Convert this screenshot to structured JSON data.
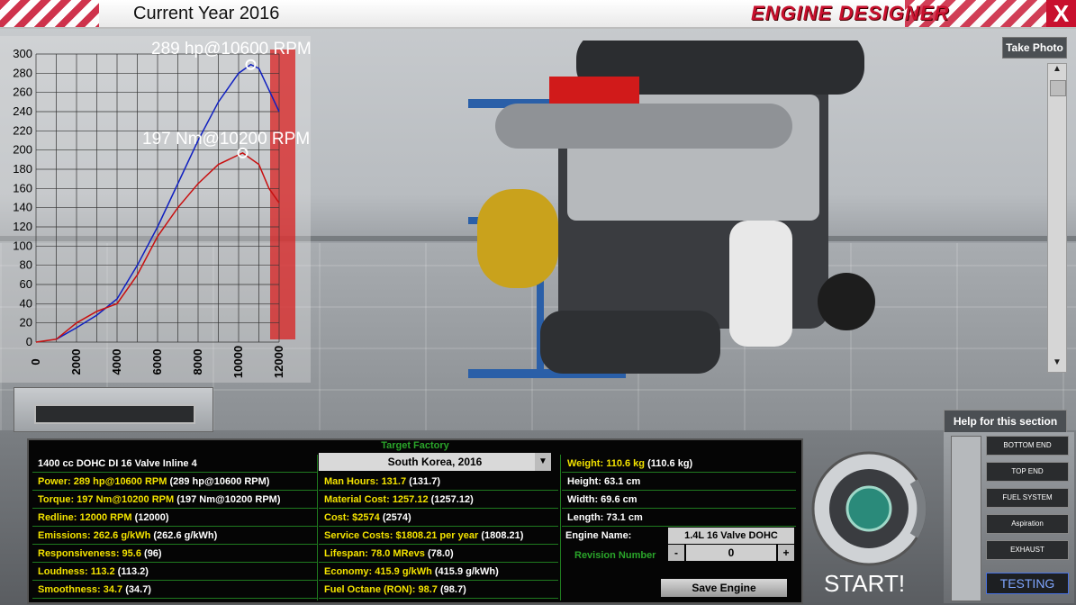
{
  "header": {
    "current_year": "Current Year 2016",
    "app_title": "ENGINE DESIGNER",
    "close_label": "X"
  },
  "scene": {
    "take_photo_label": "Take Photo",
    "help_label": "Help for this section"
  },
  "chart_data": {
    "type": "line",
    "annotations": [
      "289 hp@10600 RPM",
      "197 Nm@10200 RPM"
    ],
    "x_ticks": [
      "0",
      "2000",
      "4000",
      "6000",
      "8000",
      "10000",
      "12000"
    ],
    "y_ticks": [
      "0",
      "20",
      "40",
      "60",
      "80",
      "100",
      "120",
      "140",
      "160",
      "180",
      "200",
      "220",
      "240",
      "260",
      "280",
      "300"
    ],
    "xlim": [
      0,
      12000
    ],
    "ylim": [
      0,
      300
    ],
    "grid": true,
    "series": [
      {
        "color": "#1020c0",
        "x": [
          1000,
          2000,
          3000,
          4000,
          5000,
          6000,
          7000,
          8000,
          9000,
          10000,
          10600,
          11000,
          12000
        ],
        "values": [
          3,
          15,
          28,
          45,
          80,
          120,
          165,
          210,
          250,
          280,
          289,
          285,
          240
        ]
      },
      {
        "color": "#c81010",
        "x": [
          0,
          1000,
          2000,
          3000,
          4000,
          5000,
          6000,
          7000,
          8000,
          9000,
          10200,
          11000,
          11500,
          12000
        ],
        "values": [
          0,
          3,
          20,
          32,
          40,
          70,
          110,
          140,
          165,
          185,
          197,
          185,
          160,
          145
        ]
      }
    ]
  },
  "stats": {
    "target_factory_label": "Target Factory",
    "engine_summary": "1400 cc DOHC DI 16 Valve Inline 4",
    "factory_value": "South Korea, 2016",
    "col1": [
      {
        "label": "Power:",
        "value": "289 hp@10600 RPM",
        "extra": "(289 hp@10600 RPM)"
      },
      {
        "label": "Torque:",
        "value": "197 Nm@10200 RPM",
        "extra": "(197 Nm@10200 RPM)"
      },
      {
        "label": "Redline:",
        "value": "12000 RPM",
        "extra": "(12000)"
      },
      {
        "label": "Emissions:",
        "value": "262.6 g/kWh",
        "extra": "(262.6 g/kWh)"
      },
      {
        "label": "Responsiveness:",
        "value": "95.6",
        "extra": "(96)"
      },
      {
        "label": "Loudness:",
        "value": "113.2",
        "extra": "(113.2)"
      },
      {
        "label": "Smoothness:",
        "value": "34.7",
        "extra": "(34.7)"
      }
    ],
    "col2": [
      {
        "label": "Man Hours:",
        "value": "131.7",
        "extra": "(131.7)"
      },
      {
        "label": "Material Cost:",
        "value": "1257.12",
        "extra": "(1257.12)"
      },
      {
        "label": "Cost:",
        "value": "$2574",
        "extra": "(2574)"
      },
      {
        "label": "Service Costs:",
        "value": "$1808.21 per year",
        "extra": "(1808.21)"
      },
      {
        "label": "Lifespan:",
        "value": "78.0 MRevs",
        "extra": "(78.0)"
      },
      {
        "label": "Economy:",
        "value": "415.9 g/kWh",
        "extra": "(415.9 g/kWh)"
      },
      {
        "label": "Fuel Octane (RON):",
        "value": "98.7",
        "extra": "(98.7)"
      }
    ],
    "col3": [
      {
        "label": "Weight:",
        "value": "110.6 kg",
        "extra": "(110.6 kg)"
      },
      {
        "label": "Height:",
        "value": "63.1 cm",
        "extra": ""
      },
      {
        "label": "Width:",
        "value": "69.6 cm",
        "extra": ""
      },
      {
        "label": "Length:",
        "value": "73.1 cm",
        "extra": ""
      }
    ],
    "engine_name_label": "Engine Name:",
    "engine_name_value": "1.4L 16 Valve DOHC",
    "revision_label": "Revision Number",
    "revision_value": "0",
    "minus_label": "-",
    "plus_label": "+",
    "save_label": "Save Engine"
  },
  "controls": {
    "start_label": "START!",
    "nav": [
      "BOTTOM END",
      "TOP END",
      "FUEL SYSTEM",
      "Aspiration",
      "EXHAUST"
    ],
    "testing_label": "TESTING"
  }
}
